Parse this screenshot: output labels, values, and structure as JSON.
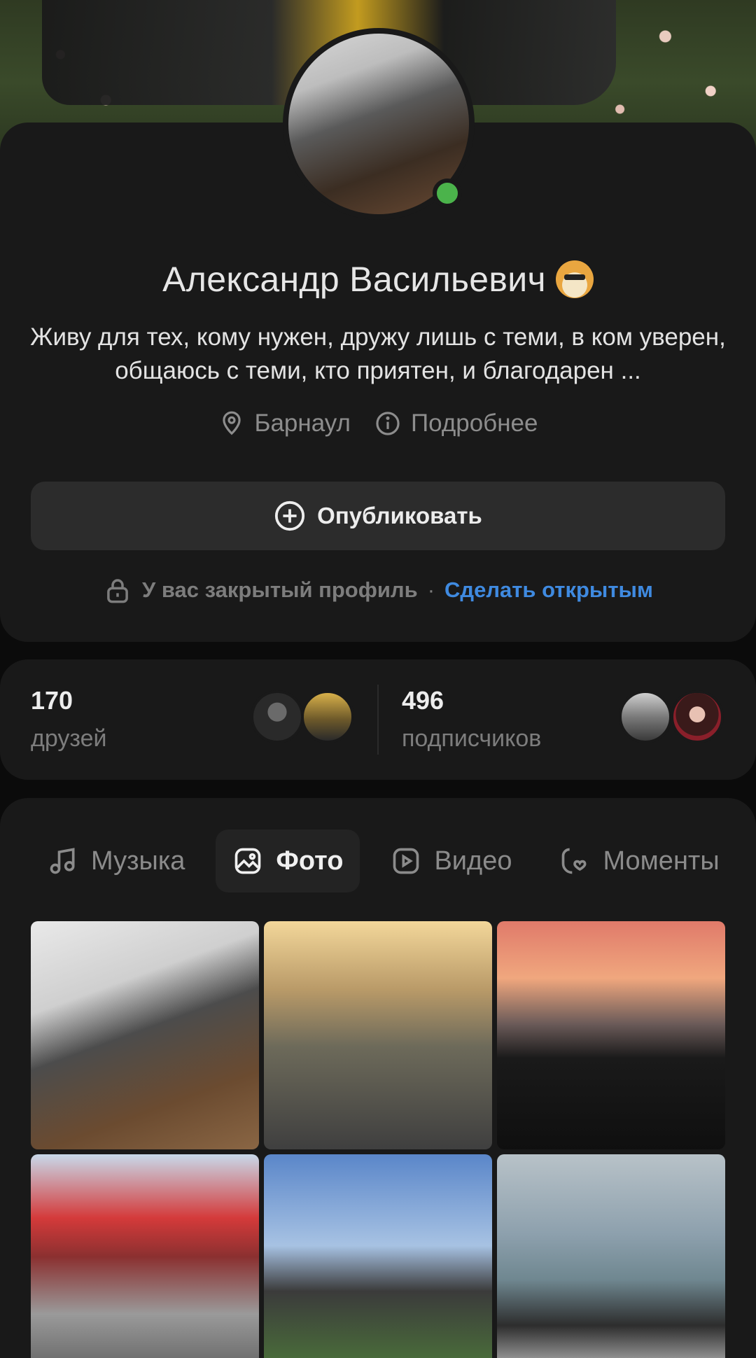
{
  "profile": {
    "name": "Александр Васильевич",
    "status": "Живу для тех, кому нужен, дружу лишь с теми, в ком уверен, общаюсь с теми, кто приятен, и благодарен ...",
    "city": "Барнаул",
    "details_label": "Подробнее",
    "online": true,
    "online_color": "#4bb34b"
  },
  "actions": {
    "publish_label": "Опубликовать"
  },
  "privacy": {
    "text": "У вас закрытый профиль",
    "separator": "·",
    "make_open_label": "Сделать открытым",
    "link_color": "#3f8ae0"
  },
  "counters": {
    "friends": {
      "count": "170",
      "label": "друзей"
    },
    "followers": {
      "count": "496",
      "label": "подписчиков"
    }
  },
  "tabs": [
    {
      "label": "Музыка",
      "icon": "music-note-icon",
      "active": false
    },
    {
      "label": "Фото",
      "icon": "image-icon",
      "active": true
    },
    {
      "label": "Видео",
      "icon": "play-icon",
      "active": false
    },
    {
      "label": "Моменты",
      "icon": "heart-clip-icon",
      "active": false
    }
  ],
  "photos": [
    {
      "subject": "tattoo-arm"
    },
    {
      "subject": "selfie-embankment"
    },
    {
      "subject": "motorcycle-sunset"
    },
    {
      "subject": "memorial-flags"
    },
    {
      "subject": "group-friends"
    },
    {
      "subject": "two-friends-river"
    }
  ]
}
